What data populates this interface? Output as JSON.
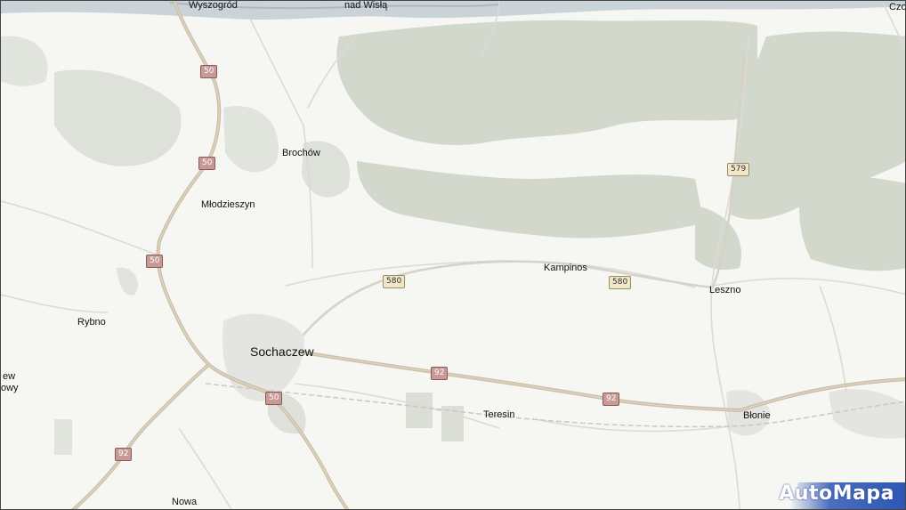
{
  "map": {
    "places": {
      "wyszogrod": "Wyszogród",
      "nad_wisla": "nad Wisłą",
      "czo": "Czo",
      "brochow": "Brochów",
      "mlodzieszyn": "Młodzieszyn",
      "kampinos": "Kampinos",
      "leszno": "Leszno",
      "rybno": "Rybno",
      "sochaczew": "Sochaczew",
      "teresin": "Teresin",
      "blonie": "Błonie",
      "nowa": "Nowa",
      "ew": "ew",
      "owy": "owy"
    },
    "road_numbers": {
      "r50a": "50",
      "r50b": "50",
      "r50c": "50",
      "r50d": "50",
      "r92a": "92",
      "r92b": "92",
      "r92c": "92",
      "r580a": "580",
      "r580b": "580",
      "r579": "579"
    },
    "logo": "AutoMapa",
    "colors": {
      "background": "#f6f6f3",
      "forest": "#d3d8cd",
      "national_road": "#c9bda6",
      "national_shield": "#c79a96",
      "regional_shield": "#f2e6c8",
      "logo_blue": "#2e56b5"
    }
  }
}
